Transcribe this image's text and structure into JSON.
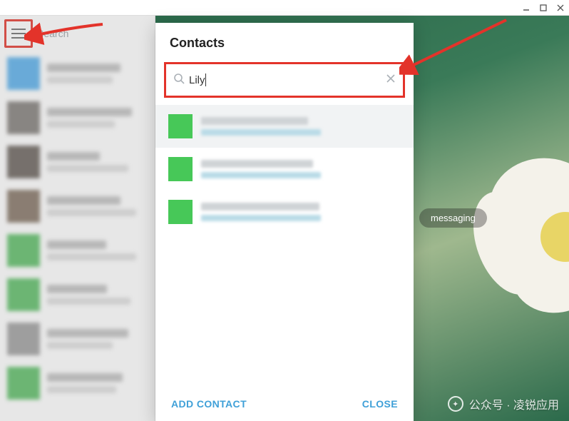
{
  "window": {
    "minimize_tip": "_",
    "maximize_tip": "▢",
    "close_tip": "✕"
  },
  "sidebar": {
    "search_placeholder": "Search",
    "chats": [
      {
        "avatar_color": "#3aa1e8"
      },
      {
        "avatar_color": "#6b6661"
      },
      {
        "avatar_color": "#4f463f"
      },
      {
        "avatar_color": "#6e5a48"
      },
      {
        "avatar_color": "#3fb24a"
      },
      {
        "avatar_color": "#3fb24a"
      },
      {
        "avatar_color": "#8e8e8e"
      },
      {
        "avatar_color": "#3fb24a"
      }
    ]
  },
  "main": {
    "status_pill": "messaging"
  },
  "dialog": {
    "title": "Contacts",
    "search_value": "Lily",
    "clear_tip": "clear",
    "results": [
      {
        "selected": true
      },
      {
        "selected": false
      },
      {
        "selected": false
      }
    ],
    "add_contact_label": "ADD CONTACT",
    "close_label": "CLOSE"
  },
  "watermark": {
    "text": "公众号 · 凌锐应用"
  }
}
